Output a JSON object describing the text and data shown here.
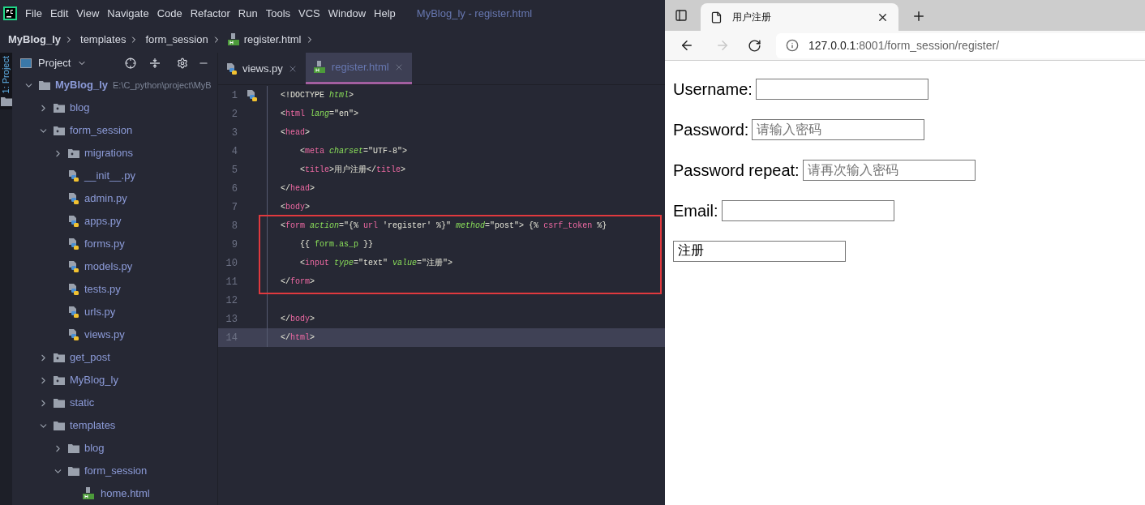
{
  "ide": {
    "menu": [
      "File",
      "Edit",
      "View",
      "Navigate",
      "Code",
      "Refactor",
      "Run",
      "Tools",
      "VCS",
      "Window",
      "Help"
    ],
    "window_title": "MyBlog_ly - register.html",
    "breadcrumbs": [
      {
        "label": "MyBlog_ly",
        "kind": "project"
      },
      {
        "label": "templates",
        "kind": "folder"
      },
      {
        "label": "form_session",
        "kind": "folder"
      },
      {
        "label": "register.html",
        "kind": "html"
      }
    ],
    "side_stripe": "1: Project",
    "project_panel": {
      "title": "Project",
      "tree": [
        {
          "label": "MyBlog_ly",
          "kind": "root",
          "path": "E:\\C_python\\project\\MyB",
          "expanded": true,
          "children": [
            {
              "label": "blog",
              "kind": "package",
              "expanded": false
            },
            {
              "label": "form_session",
              "kind": "package",
              "expanded": true,
              "children": [
                {
                  "label": "migrations",
                  "kind": "package",
                  "expanded": false
                },
                {
                  "label": "__init__.py",
                  "kind": "python"
                },
                {
                  "label": "admin.py",
                  "kind": "python"
                },
                {
                  "label": "apps.py",
                  "kind": "python"
                },
                {
                  "label": "forms.py",
                  "kind": "python"
                },
                {
                  "label": "models.py",
                  "kind": "python"
                },
                {
                  "label": "tests.py",
                  "kind": "python"
                },
                {
                  "label": "urls.py",
                  "kind": "python"
                },
                {
                  "label": "views.py",
                  "kind": "python"
                }
              ]
            },
            {
              "label": "get_post",
              "kind": "package",
              "expanded": false
            },
            {
              "label": "MyBlog_ly",
              "kind": "package",
              "expanded": false
            },
            {
              "label": "static",
              "kind": "folder",
              "expanded": false
            },
            {
              "label": "templates",
              "kind": "folder",
              "expanded": true,
              "children": [
                {
                  "label": "blog",
                  "kind": "folder",
                  "expanded": false
                },
                {
                  "label": "form_session",
                  "kind": "folder",
                  "expanded": true,
                  "children": [
                    {
                      "label": "home.html",
                      "kind": "html"
                    }
                  ]
                }
              ]
            }
          ]
        }
      ]
    },
    "editor_tabs": [
      {
        "label": "views.py",
        "kind": "python",
        "selected": false
      },
      {
        "label": "register.html",
        "kind": "html",
        "selected": true
      }
    ],
    "code_lines": [
      {
        "number": "1",
        "current": false,
        "boxed": false,
        "tokens": [
          {
            "text": "<!DOCTYPE ",
            "kind": "plain"
          },
          {
            "text": "html",
            "kind": "attr"
          },
          {
            "text": ">",
            "kind": "plain"
          }
        ]
      },
      {
        "number": "2",
        "current": false,
        "boxed": false,
        "tokens": [
          {
            "text": "<",
            "kind": "plain"
          },
          {
            "text": "html",
            "kind": "tag"
          },
          {
            "text": " lang",
            "kind": "attr"
          },
          {
            "text": "=\"en\">",
            "kind": "plain"
          }
        ]
      },
      {
        "number": "3",
        "current": false,
        "boxed": false,
        "tokens": [
          {
            "text": "<",
            "kind": "plain"
          },
          {
            "text": "head",
            "kind": "tag"
          },
          {
            "text": ">",
            "kind": "plain"
          }
        ]
      },
      {
        "number": "4",
        "current": false,
        "boxed": false,
        "tokens": [
          {
            "text": "    <",
            "kind": "plain"
          },
          {
            "text": "meta",
            "kind": "tag"
          },
          {
            "text": " charset",
            "kind": "attr"
          },
          {
            "text": "=\"UTF-8\">",
            "kind": "plain"
          }
        ]
      },
      {
        "number": "5",
        "current": false,
        "boxed": false,
        "tokens": [
          {
            "text": "    <",
            "kind": "plain"
          },
          {
            "text": "title",
            "kind": "tag"
          },
          {
            "text": ">用户注册</",
            "kind": "plain"
          },
          {
            "text": "title",
            "kind": "tag"
          },
          {
            "text": ">",
            "kind": "plain"
          }
        ]
      },
      {
        "number": "6",
        "current": false,
        "boxed": false,
        "tokens": [
          {
            "text": "</",
            "kind": "plain"
          },
          {
            "text": "head",
            "kind": "tag"
          },
          {
            "text": ">",
            "kind": "plain"
          }
        ]
      },
      {
        "number": "7",
        "current": false,
        "boxed": false,
        "tokens": [
          {
            "text": "<",
            "kind": "plain"
          },
          {
            "text": "body",
            "kind": "tag"
          },
          {
            "text": ">",
            "kind": "plain"
          }
        ]
      },
      {
        "number": "8",
        "current": false,
        "boxed": true,
        "tokens": [
          {
            "text": "<",
            "kind": "plain"
          },
          {
            "text": "form",
            "kind": "tag"
          },
          {
            "text": " action",
            "kind": "attr"
          },
          {
            "text": "=\"{% ",
            "kind": "plain"
          },
          {
            "text": "url",
            "kind": "tag"
          },
          {
            "text": " 'register' %}\" ",
            "kind": "plain"
          },
          {
            "text": "method",
            "kind": "attr"
          },
          {
            "text": "=\"post\"> {% ",
            "kind": "plain"
          },
          {
            "text": "csrf_token",
            "kind": "tag"
          },
          {
            "text": " %}",
            "kind": "plain"
          }
        ]
      },
      {
        "number": "9",
        "current": false,
        "boxed": true,
        "tokens": [
          {
            "text": "    {{ ",
            "kind": "plain"
          },
          {
            "text": "form.as_p",
            "kind": "var"
          },
          {
            "text": " }}",
            "kind": "plain"
          }
        ]
      },
      {
        "number": "10",
        "current": false,
        "boxed": true,
        "tokens": [
          {
            "text": "    <",
            "kind": "plain"
          },
          {
            "text": "input",
            "kind": "tag"
          },
          {
            "text": " type",
            "kind": "attr"
          },
          {
            "text": "=\"text\" ",
            "kind": "plain"
          },
          {
            "text": "value",
            "kind": "attr"
          },
          {
            "text": "=\"注册\">",
            "kind": "plain"
          }
        ]
      },
      {
        "number": "11",
        "current": false,
        "boxed": true,
        "tokens": [
          {
            "text": "</",
            "kind": "plain"
          },
          {
            "text": "form",
            "kind": "tag"
          },
          {
            "text": ">",
            "kind": "plain"
          }
        ]
      },
      {
        "number": "12",
        "current": false,
        "boxed": false
      },
      {
        "number": "13",
        "current": false,
        "boxed": false,
        "tokens": [
          {
            "text": "</",
            "kind": "plain"
          },
          {
            "text": "body",
            "kind": "tag"
          },
          {
            "text": ">",
            "kind": "plain"
          }
        ]
      },
      {
        "number": "14",
        "current": true,
        "boxed": false,
        "tokens": [
          {
            "text": "</",
            "kind": "plain"
          },
          {
            "text": "html",
            "kind": "tag"
          },
          {
            "text": ">",
            "kind": "plain"
          }
        ]
      }
    ]
  },
  "browser": {
    "tab": {
      "title": "用户注册"
    },
    "address": {
      "host": "127.0.0.1",
      "rest": ":8001/form_session/register/"
    },
    "form": [
      {
        "label": "Username:"
      },
      {
        "label": "Password:",
        "placeholder": "请输入密码"
      },
      {
        "label": "Password repeat:",
        "placeholder": "请再次输入密码"
      },
      {
        "label": "Email:"
      },
      {
        "value": "注册"
      }
    ]
  }
}
